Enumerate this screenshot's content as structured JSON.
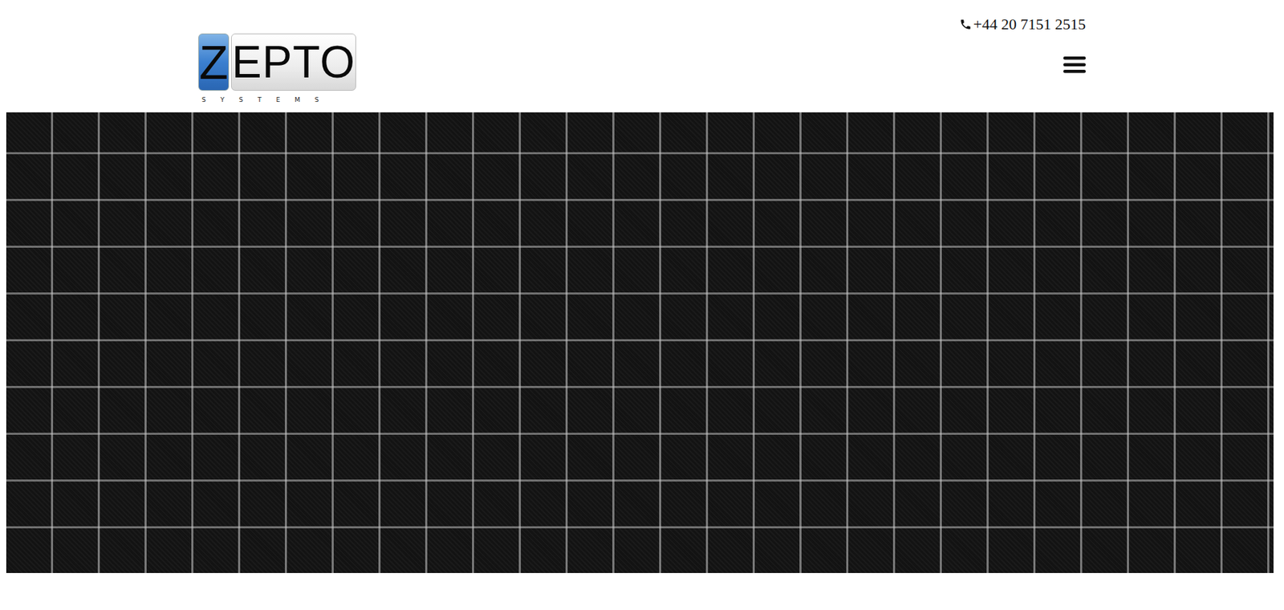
{
  "logo": {
    "mark": "Z",
    "word": "EPTO",
    "tagline": "SYSTEMS"
  },
  "contact": {
    "phone": "+44 20 7151 2515"
  },
  "menu": {
    "expanded": false
  }
}
